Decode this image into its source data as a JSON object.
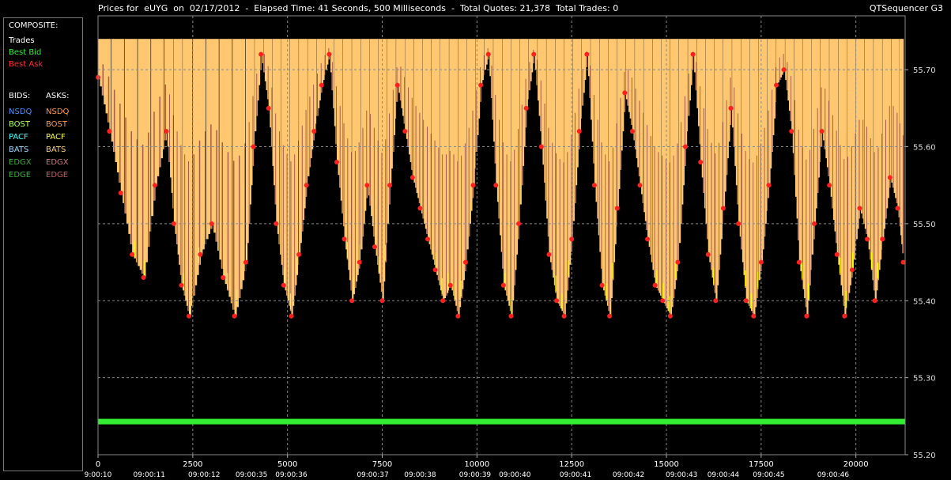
{
  "header": {
    "title": "Prices for  eUYG  on  02/17/2012  -  Elapsed Time: 41 Seconds, 500 Milliseconds  -  Total Quotes: 21,378  Total Trades: 0",
    "brand": "QTSequencer G3"
  },
  "legend": {
    "composite_title": "COMPOSITE:",
    "composite": [
      {
        "label": "Trades",
        "color": "#ffffff"
      },
      {
        "label": "Best Bid",
        "color": "#33ee33"
      },
      {
        "label": "Best Ask",
        "color": "#ff3030"
      }
    ],
    "bids_title": "BIDS:",
    "asks_title": "ASKS:",
    "exchanges": [
      {
        "bid": "NSDQ",
        "bid_color": "#4a90ff",
        "ask": "NSDQ",
        "ask_color": "#ff9a4a"
      },
      {
        "bid": "BOST",
        "bid_color": "#b0ff60",
        "ask": "BOST",
        "ask_color": "#ff9a4a"
      },
      {
        "bid": "PACF",
        "bid_color": "#40ffff",
        "ask": "PACF",
        "ask_color": "#ffff40"
      },
      {
        "bid": "BATS",
        "bid_color": "#9fd8ff",
        "ask": "BATS",
        "ask_color": "#ffd080"
      },
      {
        "bid": "EDGX",
        "bid_color": "#3aaa3a",
        "ask": "EDGX",
        "ask_color": "#c8787a"
      },
      {
        "bid": "EDGE",
        "bid_color": "#3aaa3a",
        "ask": "EDGE",
        "ask_color": "#c06060"
      }
    ]
  },
  "chart_data": {
    "type": "scatter",
    "ylim": [
      55.2,
      55.77
    ],
    "xlim": [
      0,
      21300
    ],
    "y_ticks": [
      "55.70",
      "55.60",
      "55.50",
      "55.40",
      "55.30",
      "55.20"
    ],
    "y_tick_values": [
      55.7,
      55.6,
      55.5,
      55.4,
      55.3,
      55.2
    ],
    "x_ticks": [
      0,
      2500,
      5000,
      7500,
      10000,
      12500,
      15000,
      17500,
      20000
    ],
    "time_labels": [
      {
        "x": 0,
        "label": "9:00:10"
      },
      {
        "x": 1350,
        "label": "09:00:11"
      },
      {
        "x": 2800,
        "label": "09:00:12"
      },
      {
        "x": 4050,
        "label": "09:00:35"
      },
      {
        "x": 5100,
        "label": "09:00:36"
      },
      {
        "x": 7250,
        "label": "09:00:37"
      },
      {
        "x": 8500,
        "label": "09:00:38"
      },
      {
        "x": 9950,
        "label": "09:00:39"
      },
      {
        "x": 11000,
        "label": "09:00:40"
      },
      {
        "x": 12600,
        "label": "09:00:41"
      },
      {
        "x": 14000,
        "label": "09:00:42"
      },
      {
        "x": 15400,
        "label": "09:00:43"
      },
      {
        "x": 16500,
        "label": "09:00:44"
      },
      {
        "x": 17700,
        "label": "09:00:45"
      },
      {
        "x": 19400,
        "label": "09:00:46"
      }
    ],
    "series": [
      {
        "name": "Best Bid",
        "color": "#33ee33",
        "values": [
          [
            0,
            55.243
          ],
          [
            21300,
            55.243
          ]
        ]
      },
      {
        "name": "Best Ask",
        "color": "#ff2020",
        "values": [
          [
            0,
            55.69
          ],
          [
            300,
            55.62
          ],
          [
            600,
            55.54
          ],
          [
            900,
            55.46
          ],
          [
            1200,
            55.43
          ],
          [
            1500,
            55.55
          ],
          [
            1800,
            55.62
          ],
          [
            2000,
            55.5
          ],
          [
            2200,
            55.42
          ],
          [
            2400,
            55.38
          ],
          [
            2700,
            55.46
          ],
          [
            3000,
            55.5
          ],
          [
            3300,
            55.43
          ],
          [
            3600,
            55.38
          ],
          [
            3900,
            55.45
          ],
          [
            4100,
            55.6
          ],
          [
            4300,
            55.72
          ],
          [
            4500,
            55.65
          ],
          [
            4700,
            55.5
          ],
          [
            4900,
            55.42
          ],
          [
            5100,
            55.38
          ],
          [
            5300,
            55.46
          ],
          [
            5500,
            55.55
          ],
          [
            5700,
            55.62
          ],
          [
            5900,
            55.68
          ],
          [
            6100,
            55.72
          ],
          [
            6300,
            55.58
          ],
          [
            6500,
            55.48
          ],
          [
            6700,
            55.4
          ],
          [
            6900,
            55.45
          ],
          [
            7100,
            55.55
          ],
          [
            7300,
            55.47
          ],
          [
            7500,
            55.4
          ],
          [
            7700,
            55.55
          ],
          [
            7900,
            55.68
          ],
          [
            8100,
            55.62
          ],
          [
            8300,
            55.56
          ],
          [
            8500,
            55.52
          ],
          [
            8700,
            55.48
          ],
          [
            8900,
            55.44
          ],
          [
            9100,
            55.4
          ],
          [
            9300,
            55.42
          ],
          [
            9500,
            55.38
          ],
          [
            9700,
            55.45
          ],
          [
            9900,
            55.55
          ],
          [
            10100,
            55.68
          ],
          [
            10300,
            55.72
          ],
          [
            10500,
            55.55
          ],
          [
            10700,
            55.42
          ],
          [
            10900,
            55.38
          ],
          [
            11100,
            55.5
          ],
          [
            11300,
            55.65
          ],
          [
            11500,
            55.72
          ],
          [
            11700,
            55.6
          ],
          [
            11900,
            55.46
          ],
          [
            12100,
            55.4
          ],
          [
            12300,
            55.38
          ],
          [
            12500,
            55.48
          ],
          [
            12700,
            55.62
          ],
          [
            12900,
            55.72
          ],
          [
            13100,
            55.55
          ],
          [
            13300,
            55.42
          ],
          [
            13500,
            55.38
          ],
          [
            13700,
            55.52
          ],
          [
            13900,
            55.67
          ],
          [
            14100,
            55.62
          ],
          [
            14300,
            55.55
          ],
          [
            14500,
            55.48
          ],
          [
            14700,
            55.42
          ],
          [
            14900,
            55.4
          ],
          [
            15100,
            55.38
          ],
          [
            15300,
            55.45
          ],
          [
            15500,
            55.6
          ],
          [
            15700,
            55.72
          ],
          [
            15900,
            55.58
          ],
          [
            16100,
            55.46
          ],
          [
            16300,
            55.4
          ],
          [
            16500,
            55.52
          ],
          [
            16700,
            55.65
          ],
          [
            16900,
            55.5
          ],
          [
            17100,
            55.4
          ],
          [
            17300,
            55.38
          ],
          [
            17500,
            55.45
          ],
          [
            17700,
            55.55
          ],
          [
            17900,
            55.68
          ],
          [
            18100,
            55.7
          ],
          [
            18300,
            55.62
          ],
          [
            18500,
            55.45
          ],
          [
            18700,
            55.38
          ],
          [
            18900,
            55.5
          ],
          [
            19100,
            55.62
          ],
          [
            19300,
            55.55
          ],
          [
            19500,
            55.46
          ],
          [
            19700,
            55.38
          ],
          [
            19900,
            55.44
          ],
          [
            20100,
            55.52
          ],
          [
            20300,
            55.48
          ],
          [
            20500,
            55.4
          ],
          [
            20700,
            55.48
          ],
          [
            20900,
            55.56
          ],
          [
            21100,
            55.52
          ],
          [
            21250,
            55.45
          ]
        ]
      }
    ],
    "fill_colors": {
      "ask_fill": "#ffc870",
      "bid_fill": "#a85a48",
      "yellow": "#ffff00",
      "grid": "#888888"
    }
  }
}
